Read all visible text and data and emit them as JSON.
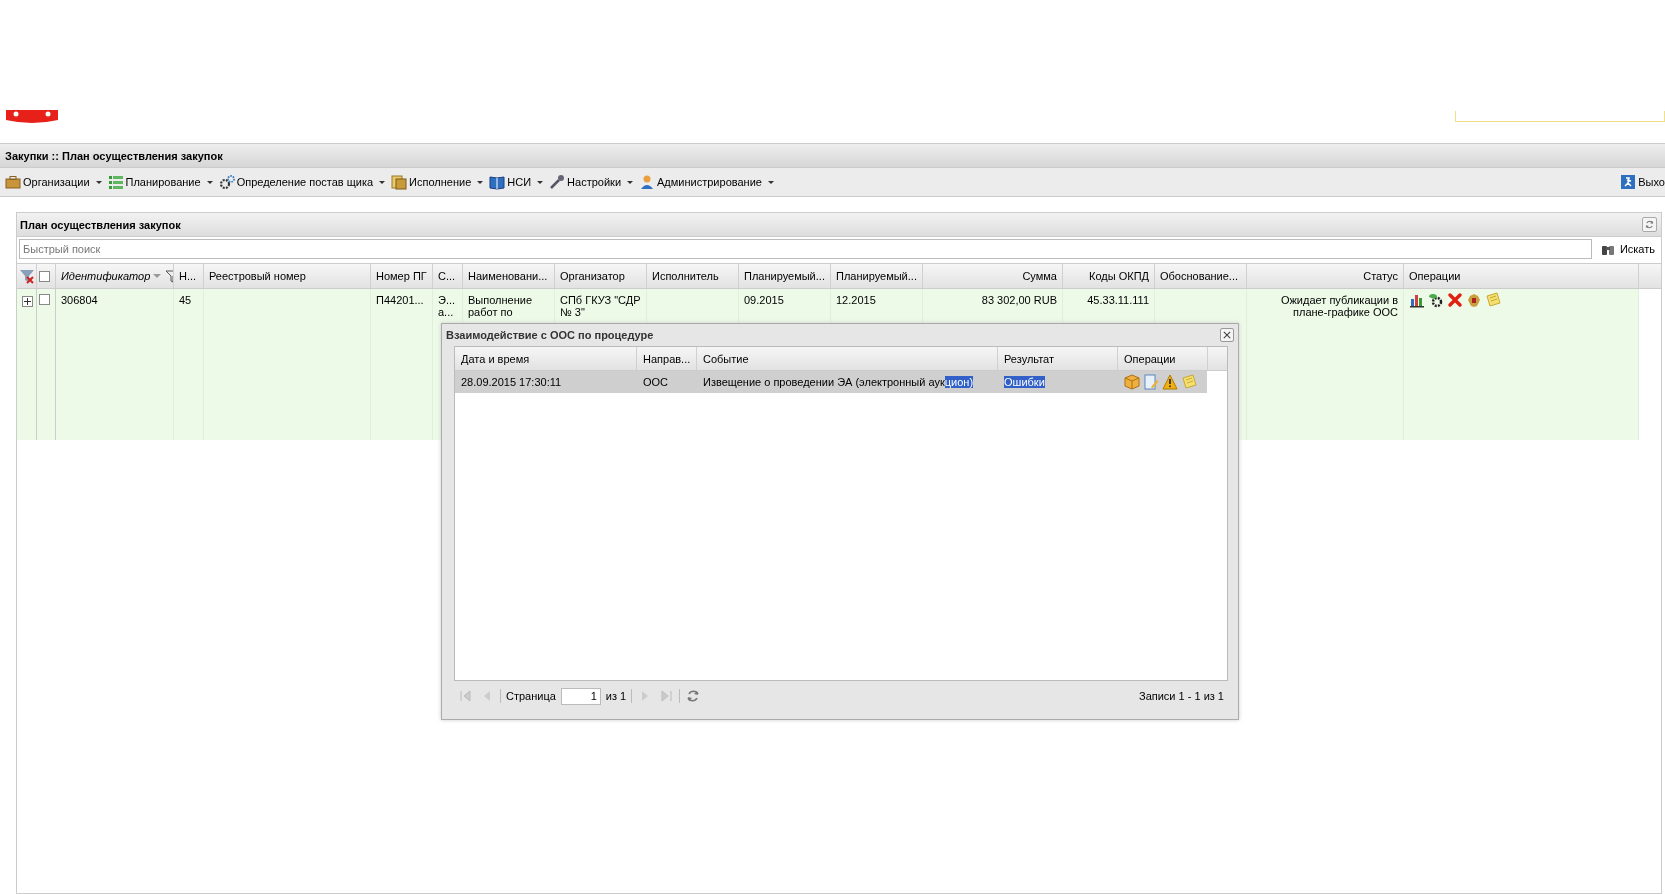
{
  "window": {
    "title": "Закупки :: План осуществления закупок"
  },
  "menu": [
    {
      "label": "Организации"
    },
    {
      "label": "Планирование"
    },
    {
      "label": "Определение постав щика"
    },
    {
      "label": "Исполнение"
    },
    {
      "label": "НСИ"
    },
    {
      "label": "Настройки"
    },
    {
      "label": "Администрирование"
    }
  ],
  "exit": {
    "label": "Выхо"
  },
  "panel": {
    "title": "План осуществления закупок",
    "search": {
      "placeholder": "Быстрый поиск",
      "button": "Искать"
    }
  },
  "grid": {
    "header_checked": false,
    "columns": [
      {
        "label": "Идентификатор",
        "sorted": true,
        "filtered": true
      },
      {
        "label": "Н...",
        "sorted": false,
        "filtered": false
      },
      {
        "label": "Реестровый номер",
        "sorted": false,
        "filtered": false
      },
      {
        "label": "Номер ПГ",
        "sorted": false,
        "filtered": false
      },
      {
        "label": "С...",
        "sorted": false,
        "filtered": false
      },
      {
        "label": "Наименовани...",
        "sorted": false,
        "filtered": false
      },
      {
        "label": "Организатор",
        "sorted": false,
        "filtered": false
      },
      {
        "label": "Исполнитель",
        "sorted": false,
        "filtered": false
      },
      {
        "label": "Планируемый...",
        "sorted": false,
        "filtered": false
      },
      {
        "label": "Планируемый...",
        "sorted": false,
        "filtered": false
      },
      {
        "label": "Сумма",
        "sorted": false,
        "filtered": false
      },
      {
        "label": "Коды ОКПД",
        "sorted": false,
        "filtered": false
      },
      {
        "label": "Обоснование...",
        "sorted": false,
        "filtered": false
      },
      {
        "label": "Статус",
        "sorted": false,
        "filtered": false
      },
      {
        "label": "Операции",
        "sorted": false,
        "filtered": false
      }
    ],
    "rows": [
      {
        "expanded": false,
        "checked": false,
        "cells": [
          "306804",
          "45",
          null,
          "П44201...",
          "Э... а...",
          "Выполнение работ по",
          "СПб ГКУЗ \"СДР № 3\"",
          null,
          "09.2015",
          "12.2015",
          "83 302,00 RUB",
          "45.33.11.111",
          null,
          "Ожидает публикации в плане-графике ООС",
          null
        ]
      }
    ]
  },
  "dialog": {
    "title": "Взаимодействие с ООС по процедуре",
    "columns": [
      "Дата и время",
      "Направ...",
      "Событие",
      "Результат",
      "Операции"
    ],
    "rows": [
      {
        "selected": true,
        "date": "28.09.2015 17:30:11",
        "direction": "ООС",
        "event": {
          "text": "Извещение о проведении ЭА (электронный аук",
          "highlighted": "цион)"
        },
        "result": {
          "text": "Ошибки",
          "highlighted": true
        }
      }
    ],
    "pager": {
      "page_label": "Страница",
      "page": "1",
      "of": "из 1",
      "records": "Записи 1 - 1 из 1"
    }
  }
}
